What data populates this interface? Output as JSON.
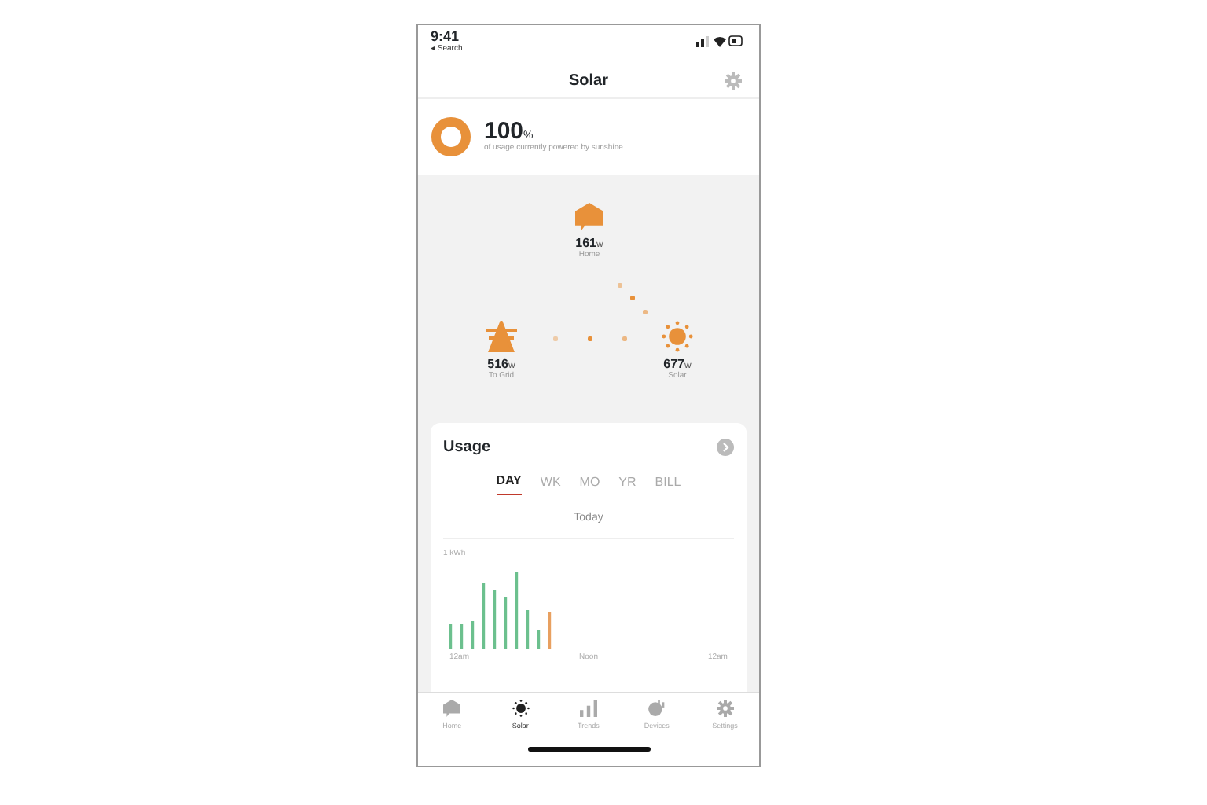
{
  "status_bar": {
    "time": "9:41",
    "back": "◂ Search"
  },
  "header": {
    "title": "Solar"
  },
  "summary": {
    "value": "100",
    "unit": "%",
    "caption": "of usage currently powered by sunshine",
    "level": 1
  },
  "flow": [
    {
      "kind": "home",
      "value": "161",
      "unit": "w",
      "label": "Home"
    },
    {
      "kind": "grid",
      "value": "516",
      "unit": "w",
      "label": "To Grid"
    },
    {
      "kind": "solar",
      "value": "677",
      "unit": "w",
      "label": "Solar"
    }
  ],
  "usage": {
    "title": "Usage",
    "tabs": [
      {
        "label": "DAY",
        "selected": true
      },
      {
        "label": "WK",
        "selected": false
      },
      {
        "label": "MO",
        "selected": false
      },
      {
        "label": "YR",
        "selected": false
      },
      {
        "label": "BILL",
        "selected": false
      }
    ],
    "period": "Today",
    "y_label": "1 kWh",
    "x_labels": [
      "12am",
      "Noon",
      "12am"
    ]
  },
  "nav": [
    {
      "kind": "home",
      "label": "Home",
      "selected": false
    },
    {
      "kind": "solar",
      "label": "Solar",
      "selected": true
    },
    {
      "kind": "trends",
      "label": "Trends",
      "selected": false
    },
    {
      "kind": "devices",
      "label": "Devices",
      "selected": false
    },
    {
      "kind": "settings",
      "label": "Settings",
      "selected": false
    }
  ]
}
